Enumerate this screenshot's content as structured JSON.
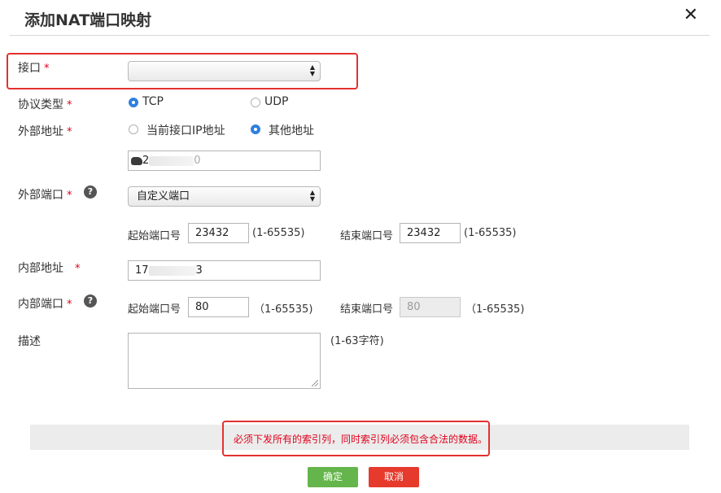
{
  "dialog": {
    "title": "添加NAT端口映射",
    "close": "✕"
  },
  "required_mark": "*",
  "form": {
    "interface": {
      "label": "接口",
      "value": ""
    },
    "protocol": {
      "label": "协议类型",
      "options": [
        "TCP",
        "UDP"
      ],
      "selected": "TCP"
    },
    "external_address": {
      "label": "外部地址",
      "options": [
        "当前接口IP地址",
        "其他地址"
      ],
      "selected": "其他地址",
      "value_visible_start": "2",
      "value_visible_end": "0"
    },
    "external_port": {
      "label": "外部端口",
      "help": "?",
      "select_value": "自定义端口",
      "start_label": "起始端口号",
      "start_value": "23432",
      "start_range": "(1-65535)",
      "end_label": "结束端口号",
      "end_value": "23432",
      "end_range": "(1-65535)"
    },
    "internal_address": {
      "label": "内部地址",
      "value_visible_start": "17",
      "value_visible_end": "3"
    },
    "internal_port": {
      "label": "内部端口",
      "help": "?",
      "start_label": "起始端口号",
      "start_value": "80",
      "start_range": "（1-65535)",
      "end_label": "结束端口号",
      "end_value": "80",
      "end_range": "（1-65535)"
    },
    "description": {
      "label": "描述",
      "value": "",
      "hint": "(1-63字符)"
    }
  },
  "error_message": "必须下发所有的索引列，同时索引列必须包含合法的数据。",
  "buttons": {
    "ok": "确定",
    "cancel": "取消"
  },
  "colors": {
    "required": "#e0001b",
    "radio_selected": "#2e7fe0",
    "highlight_border": "#e3312f",
    "ok_button": "#64b54b",
    "cancel_button": "#e63a2c"
  }
}
